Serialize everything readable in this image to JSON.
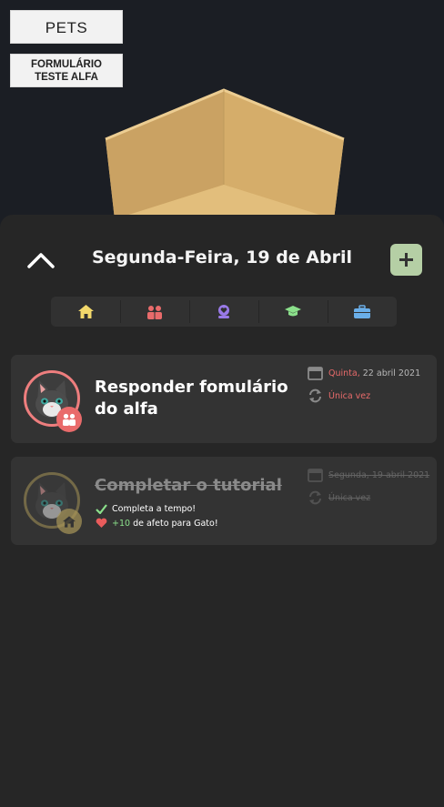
{
  "scene": {
    "pets_button": "PETS",
    "form_button_line1": "FORMULÁRIO",
    "form_button_line2": "TESTE ALFA"
  },
  "header": {
    "date_title": "Segunda-Feira, 19 de Abril",
    "collapse_icon": "chevron-up-icon",
    "add_icon": "plus-icon",
    "add_color": "#b5cfa5"
  },
  "categories": [
    {
      "icon": "home-icon",
      "color": "#f2d86b"
    },
    {
      "icon": "group-icon",
      "color": "#e96b6b"
    },
    {
      "icon": "hands-heart-icon",
      "color": "#9a7ae8"
    },
    {
      "icon": "graduation-cap-icon",
      "color": "#8be08b"
    },
    {
      "icon": "briefcase-icon",
      "color": "#6aaee8"
    }
  ],
  "tasks": [
    {
      "title": "Responder fomulário do alfa",
      "day": "Quinta,",
      "date": "22 abril 2021",
      "repeat": "Única vez",
      "accent": "#e96b6b",
      "category_icon": "group-icon"
    },
    {
      "title": "Completar o tutorial",
      "day": "Segunda,",
      "date": "19 abril 2021",
      "repeat": "Única vez",
      "accent": "#a89659",
      "category_icon": "home-icon",
      "result_ontime": "Completa a tempo!",
      "result_affection_amount": "+10",
      "result_affection_text": "de afeto para Gato!"
    }
  ]
}
